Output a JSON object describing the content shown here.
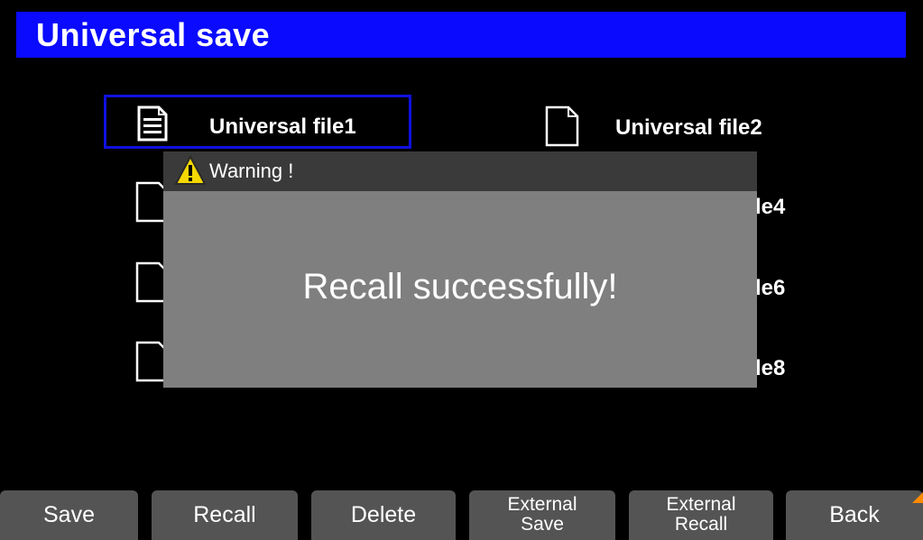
{
  "header": {
    "title": "Universal save"
  },
  "files": [
    {
      "label": "Universal file1",
      "icon": "document-filled-icon",
      "selected": true
    },
    {
      "label": "Universal file2",
      "icon": "document-empty-icon",
      "selected": false
    },
    {
      "label": "le4",
      "icon": "document-empty-icon"
    },
    {
      "label": "le6",
      "icon": "document-empty-icon"
    },
    {
      "label": "le8",
      "icon": "document-empty-icon"
    }
  ],
  "dialog": {
    "header": "Warning !",
    "icon": "warning-icon",
    "message": "Recall successfully!"
  },
  "softkeys": [
    {
      "label": "Save"
    },
    {
      "label": "Recall"
    },
    {
      "label": "Delete"
    },
    {
      "line1": "External",
      "line2": "Save"
    },
    {
      "line1": "External",
      "line2": "Recall"
    },
    {
      "label": "Back"
    }
  ],
  "colors": {
    "title_bar": "#0a0aff",
    "selection_border": "#1010e0",
    "dialog_body": "#7f7f7f",
    "dialog_header": "#3a3a3a",
    "softkey": "#545454",
    "corner_mark": "#ff8a00"
  }
}
